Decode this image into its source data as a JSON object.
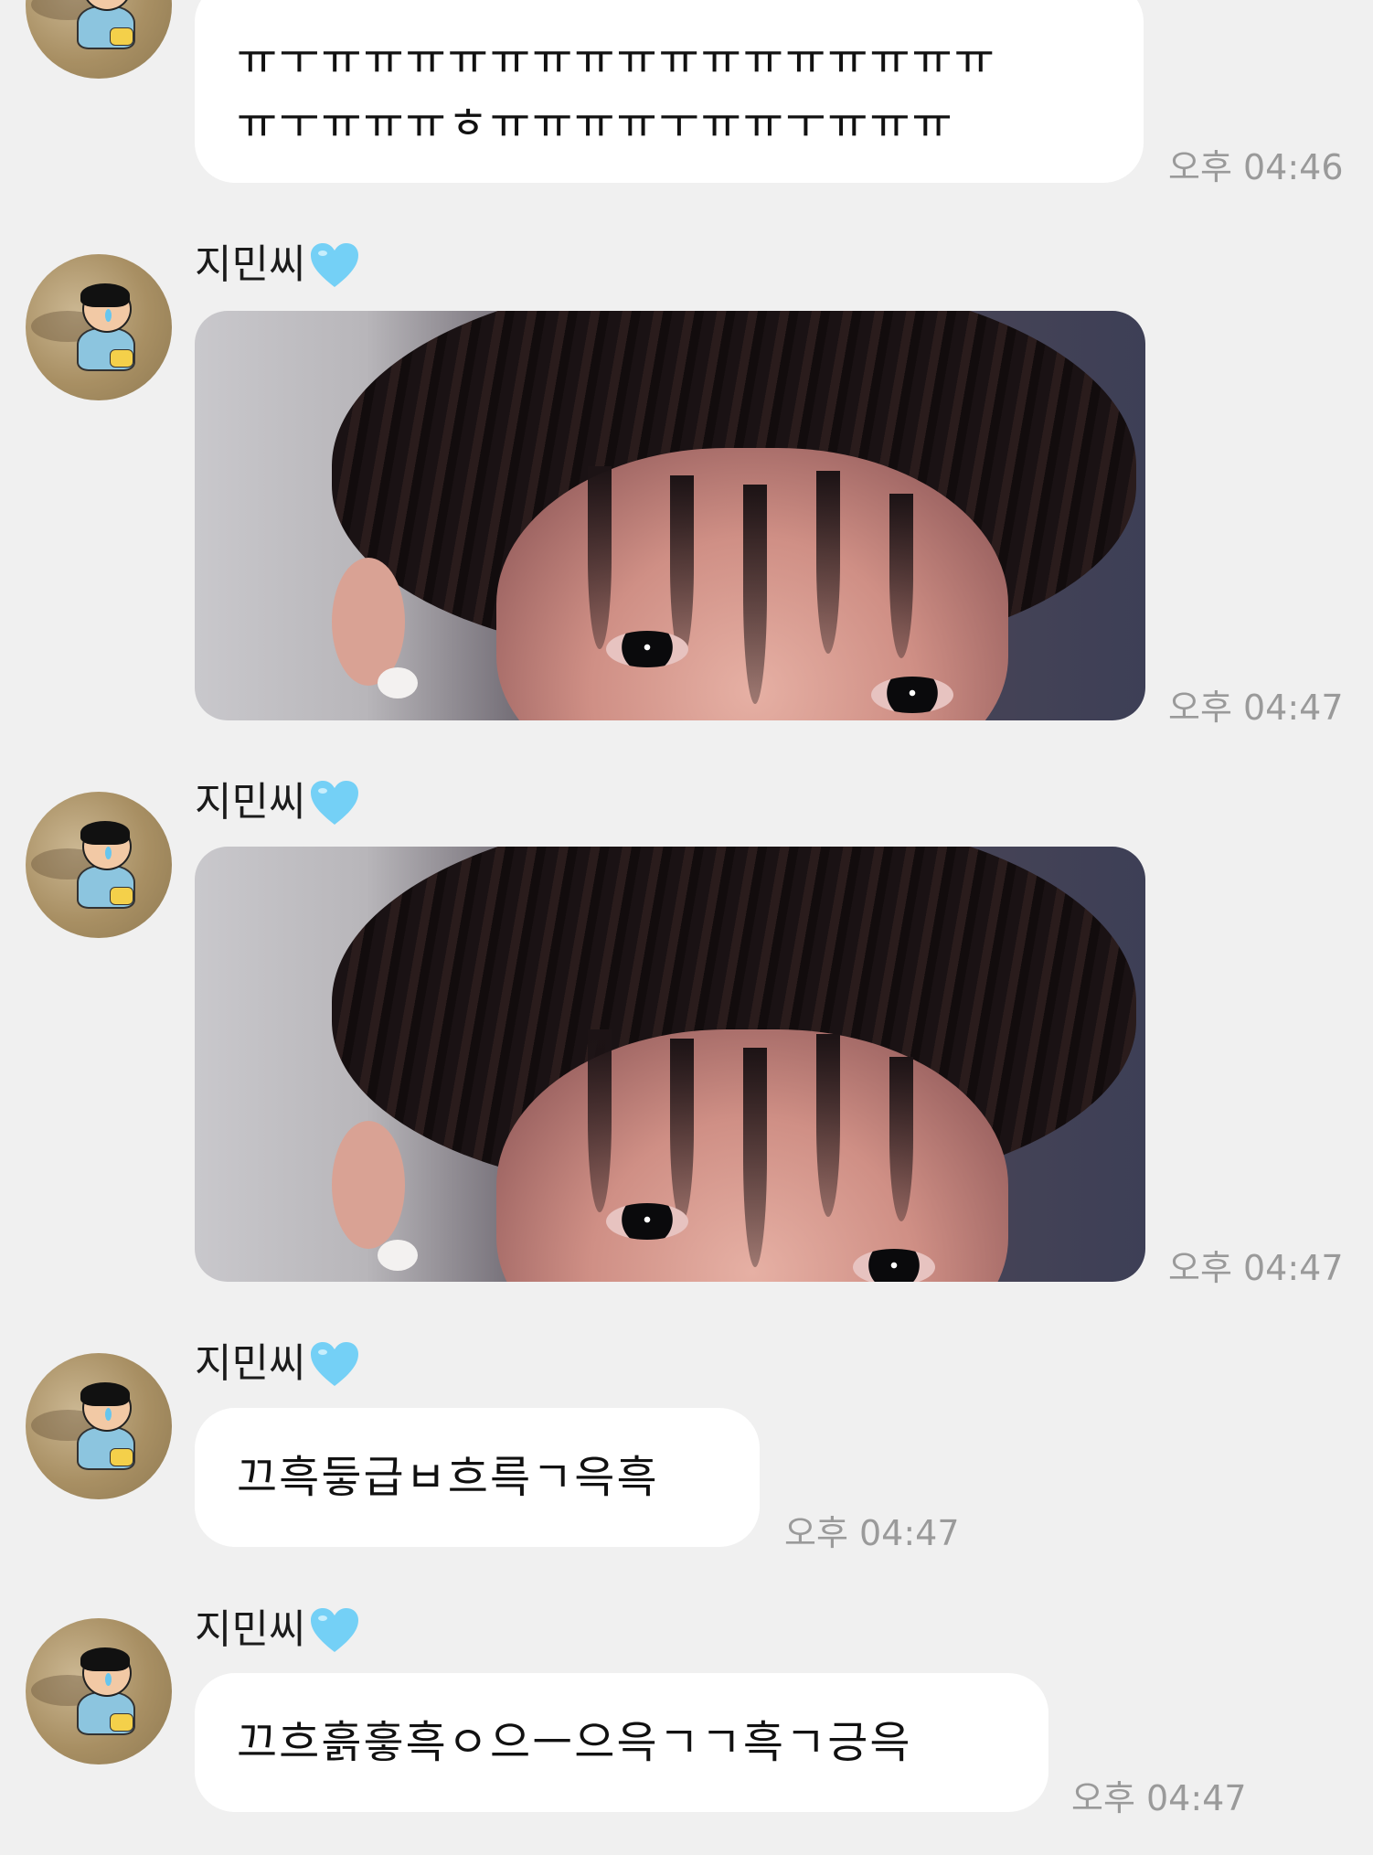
{
  "colors": {
    "background": "#f0f0f0",
    "bubble": "#ffffff",
    "timestamp": "#9a9a9a",
    "heart": "#74d0f6"
  },
  "messages": [
    {
      "type": "text",
      "lines": [
        "ㅠㅜㅠㅠㅠㅠㅠㅠㅠㅠㅠㅠㅠㅠㅠㅠㅠㅠ",
        "ㅠㅜㅠㅠㅠㅎㅠㅠㅠㅠㅜㅠㅠㅜㅠㅠㅠ"
      ],
      "time": "오후 04:46"
    },
    {
      "type": "image",
      "sender": "지민씨",
      "sender_icon": "blue-heart-icon",
      "time": "오후 04:47"
    },
    {
      "type": "image",
      "sender": "지민씨",
      "sender_icon": "blue-heart-icon",
      "time": "오후 04:47"
    },
    {
      "type": "text",
      "sender": "지민씨",
      "sender_icon": "blue-heart-icon",
      "lines": [
        "끄흑듷급ㅂ흐륵ㄱ윽흑"
      ],
      "time": "오후 04:47"
    },
    {
      "type": "text",
      "sender": "지민씨",
      "sender_icon": "blue-heart-icon",
      "lines": [
        "끄흐흙흫흑ㅇ으ㅡ으윽ㄱㄱ흑ㄱ긍윽"
      ],
      "time": "오후 04:47"
    }
  ]
}
